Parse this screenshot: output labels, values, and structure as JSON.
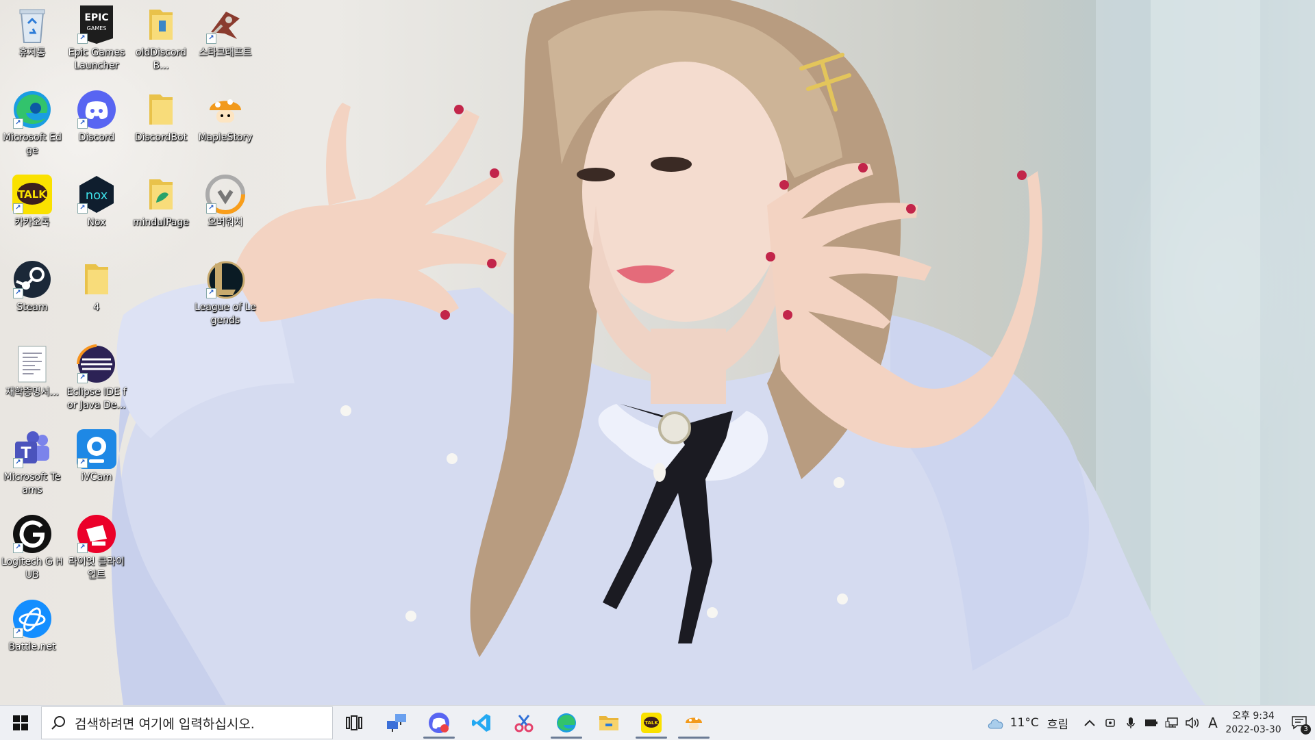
{
  "desktop": {
    "icons": [
      {
        "label": "휴지통",
        "icon": "recycle-bin-icon"
      },
      {
        "label": "Epic Games Launcher",
        "icon": "epic-games-icon"
      },
      {
        "label": "oldDiscordB...",
        "icon": "folder-icon"
      },
      {
        "label": "스타크래프트",
        "icon": "starcraft-icon"
      },
      {
        "label": "Microsoft Edge",
        "icon": "edge-icon"
      },
      {
        "label": "Discord",
        "icon": "discord-icon"
      },
      {
        "label": "DiscordBot",
        "icon": "folder-icon"
      },
      {
        "label": "MapleStory",
        "icon": "maplestory-icon"
      },
      {
        "label": "카카오톡",
        "icon": "kakaotalk-icon"
      },
      {
        "label": "Nox",
        "icon": "nox-icon"
      },
      {
        "label": "mindulPage",
        "icon": "folder-icon"
      },
      {
        "label": "오버워치",
        "icon": "overwatch-icon"
      },
      {
        "label": "Steam",
        "icon": "steam-icon"
      },
      {
        "label": "4",
        "icon": "folder-icon"
      },
      {
        "label": "League of Legends",
        "icon": "league-of-legends-icon"
      },
      {
        "label": "재학증명서...",
        "icon": "document-icon"
      },
      {
        "label": "Eclipse IDE for Java De...",
        "icon": "eclipse-icon"
      },
      {
        "label": "Microsoft Teams",
        "icon": "teams-icon"
      },
      {
        "label": "iVCam",
        "icon": "ivcam-icon"
      },
      {
        "label": "Logitech G HUB",
        "icon": "logitech-icon"
      },
      {
        "label": "라이엇 클라이언트",
        "icon": "riot-client-icon"
      },
      {
        "label": "Battle.net",
        "icon": "battlenet-icon"
      }
    ]
  },
  "taskbar": {
    "search_placeholder": "검색하려면 여기에 입력하십시오.",
    "pinned": [
      {
        "name": "task-view-icon"
      },
      {
        "name": "network-tool-icon"
      },
      {
        "name": "discord-icon"
      },
      {
        "name": "vscode-icon"
      },
      {
        "name": "snipping-tool-icon"
      },
      {
        "name": "edge-icon"
      },
      {
        "name": "file-explorer-icon"
      },
      {
        "name": "kakaotalk-icon"
      },
      {
        "name": "maplestory-icon"
      }
    ],
    "weather": {
      "temp": "11°C",
      "condition": "흐림"
    },
    "ime": "A",
    "clock": {
      "time": "오후 9:34",
      "date": "2022-03-30"
    },
    "notifications": "3"
  },
  "colors": {
    "taskbar_bg": "#eef0f4",
    "label_text": "#ffffff"
  }
}
